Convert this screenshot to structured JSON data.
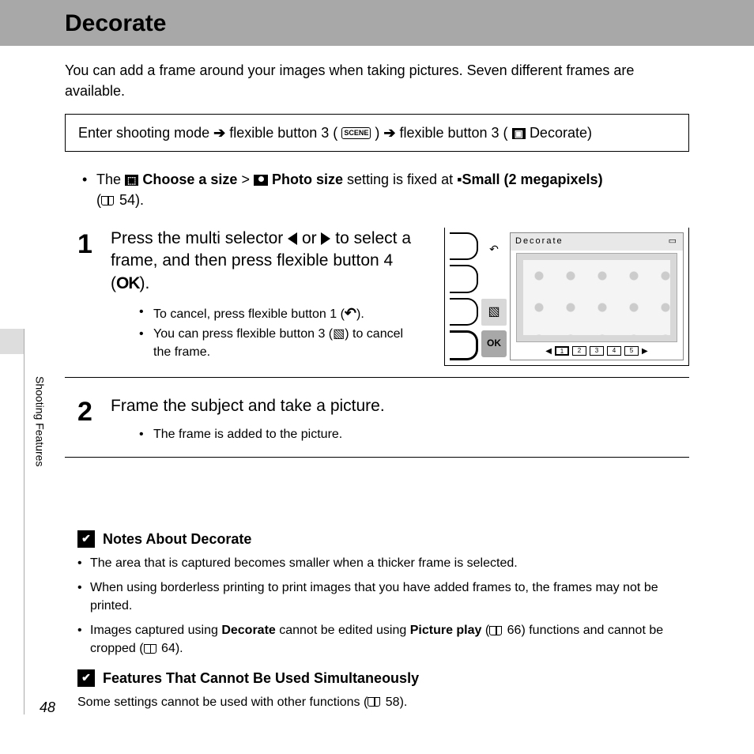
{
  "header": {
    "title": "Decorate"
  },
  "intro": "You can add a frame around your images when taking pictures. Seven different frames are available.",
  "path": {
    "p1": "Enter shooting mode ",
    "p2": " flexible button 3 (",
    "p3": ") ",
    "p4": " flexible button 3 (",
    "p5": " Decorate)"
  },
  "size_note": {
    "pre": "The ",
    "choose": " Choose a size",
    "gt": " > ",
    "photo": " Photo size",
    "mid": " setting is fixed at ",
    "small": "Small (2 megapixels)",
    "ref": " 54)."
  },
  "step1": {
    "num": "1",
    "title_a": "Press the multi selector ",
    "title_b": " or ",
    "title_c": " to select a frame, and then press flexible button 4 (",
    "ok": "OK",
    "title_d": ").",
    "sub1a": "To cancel, press flexible button 1 (",
    "sub1b": ").",
    "sub2a": "You can press flexible button 3 (",
    "sub2b": ") to cancel the frame."
  },
  "display": {
    "title": "Decorate",
    "ok": "OK",
    "thumbs": [
      "1",
      "2",
      "3",
      "4",
      "5"
    ]
  },
  "step2": {
    "num": "2",
    "title": "Frame the subject and take a picture.",
    "sub1": "The frame is added to the picture."
  },
  "notes1": {
    "header": "Notes About Decorate",
    "n1": "The area that is captured becomes smaller when a thicker frame is selected.",
    "n2": "When using borderless printing to print images that you have added frames to, the frames may not be printed.",
    "n3a": "Images captured using ",
    "decorate": "Decorate",
    "n3b": " cannot be edited using ",
    "pictureplay": "Picture play",
    "n3c": " (",
    "ref1": " 66) functions and cannot be cropped (",
    "ref2": " 64)."
  },
  "notes2": {
    "header": "Features That Cannot Be Used Simultaneously",
    "text_a": "Some settings cannot be used with other functions (",
    "ref": " 58)."
  },
  "sidebar": "Shooting Features",
  "page_number": "48"
}
